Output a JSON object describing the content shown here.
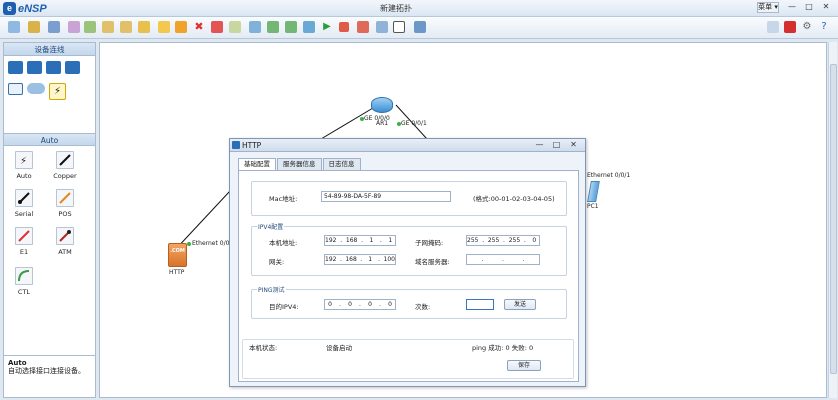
{
  "app": {
    "logo": "eNSP",
    "window_title": "新建拓扑",
    "menu_label": "菜单 ▾",
    "minimize": "—",
    "maximize": "□",
    "close": "✕"
  },
  "toolbar": {
    "icons": [
      "new-topo-icon",
      "open-icon",
      "save-icon",
      "save-as-icon",
      "print-icon",
      "undo-icon",
      "redo-icon",
      "select-icon",
      "drag-icon",
      "delete-icon",
      "delete-link-icon",
      "text-icon",
      "palette-icon",
      "zoom-in-icon",
      "zoom-out-icon",
      "fit-icon",
      "start-icon",
      "stop-icon",
      "capture-icon",
      "show-port-icon",
      "cli-icon"
    ],
    "right_icons": [
      "chat-icon",
      "huawei-icon",
      "settings-icon",
      "help-icon"
    ]
  },
  "left_panel": {
    "device_header": "设备连线",
    "cable_header": "Auto",
    "cables": [
      {
        "label": "Auto"
      },
      {
        "label": "Copper"
      },
      {
        "label": "Serial"
      },
      {
        "label": "POS"
      },
      {
        "label": "E1"
      },
      {
        "label": "ATM"
      },
      {
        "label": "CTL"
      }
    ],
    "desc_title": "Auto",
    "desc_text": "自动选择接口连接设备。"
  },
  "canvas": {
    "router": {
      "name": "AR1",
      "port_a": "GE 0/0/0",
      "port_b": "GE 0/0/1"
    },
    "http_server": {
      "name": "HTTP",
      "port": "Ethernet 0/0/0",
      "logo_text": ".COM"
    },
    "pc": {
      "name": "PC1",
      "port": "Ethernet 0/0/1"
    }
  },
  "dialog": {
    "title": "HTTP",
    "controls": {
      "minimize": "—",
      "maximize": "□",
      "close": "✕"
    },
    "tabs": [
      {
        "label": "基础配置",
        "active": true
      },
      {
        "label": "服务器信息",
        "active": false
      },
      {
        "label": "日志信息",
        "active": false
      }
    ],
    "mac_label": "Mac地址:",
    "mac_value": "54-89-98-DA-5F-89",
    "mac_hint": "(格式:00-01-02-03-04-05)",
    "ipv4_legend": "IPV4配置",
    "ip_label": "本机地址:",
    "ip": [
      "192",
      "168",
      "1",
      "1"
    ],
    "mask_label": "子网掩码:",
    "mask": [
      "255",
      "255",
      "255",
      "0"
    ],
    "gw_label": "网关:",
    "gw": [
      "192",
      "168",
      "1",
      "100"
    ],
    "dns_label": "域名服务器:",
    "dns": [
      "",
      "",
      "",
      ""
    ],
    "ping_legend": "PING测试",
    "dest_label": "目的IPV4:",
    "dest": [
      "0",
      "0",
      "0",
      "0"
    ],
    "count_label": "次数:",
    "send_button": "发送",
    "status_label": "本机状态:",
    "status_value": "设备启动",
    "ping_result": "ping 成功: 0  失败: 0",
    "save_button": "保存"
  },
  "colors": {
    "accent": "#1f5fb0",
    "canvas_bg": "#ffffff",
    "panel_bg": "#dfe7f1",
    "router_blue": "#5aa9e6",
    "server_orange": "#e8893a",
    "link_black": "#111111",
    "port_green": "#3cb043"
  }
}
